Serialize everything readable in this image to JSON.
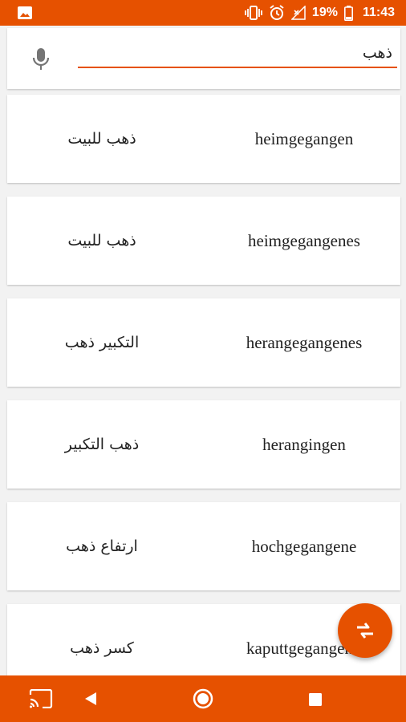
{
  "status_bar": {
    "battery_percent": "19%",
    "time": "11:43",
    "icons": [
      "image-icon",
      "vibrate-icon",
      "alarm-icon",
      "no-signal-icon",
      "battery-icon"
    ]
  },
  "search": {
    "value": "ذهب",
    "mic_icon": "microphone-icon"
  },
  "results": [
    {
      "german": "heimgegangen",
      "arabic": "ذهب للبيت"
    },
    {
      "german": "heimgegangenes",
      "arabic": "ذهب للبيت"
    },
    {
      "german": "herangegangenes",
      "arabic": "التكبير ذهب"
    },
    {
      "german": "herangingen",
      "arabic": "ذهب التكبير"
    },
    {
      "german": "hochgegangene",
      "arabic": "ارتفاع ذهب"
    },
    {
      "german": "kaputtgegangen",
      "arabic": "كسر ذهب"
    }
  ],
  "fab": {
    "icon": "swap-language-icon"
  },
  "nav_bar": {
    "icons": [
      "cast-icon",
      "back-icon",
      "home-icon",
      "recents-icon"
    ]
  },
  "colors": {
    "accent": "#e65100",
    "background": "#f2f2f2",
    "card": "#ffffff"
  }
}
